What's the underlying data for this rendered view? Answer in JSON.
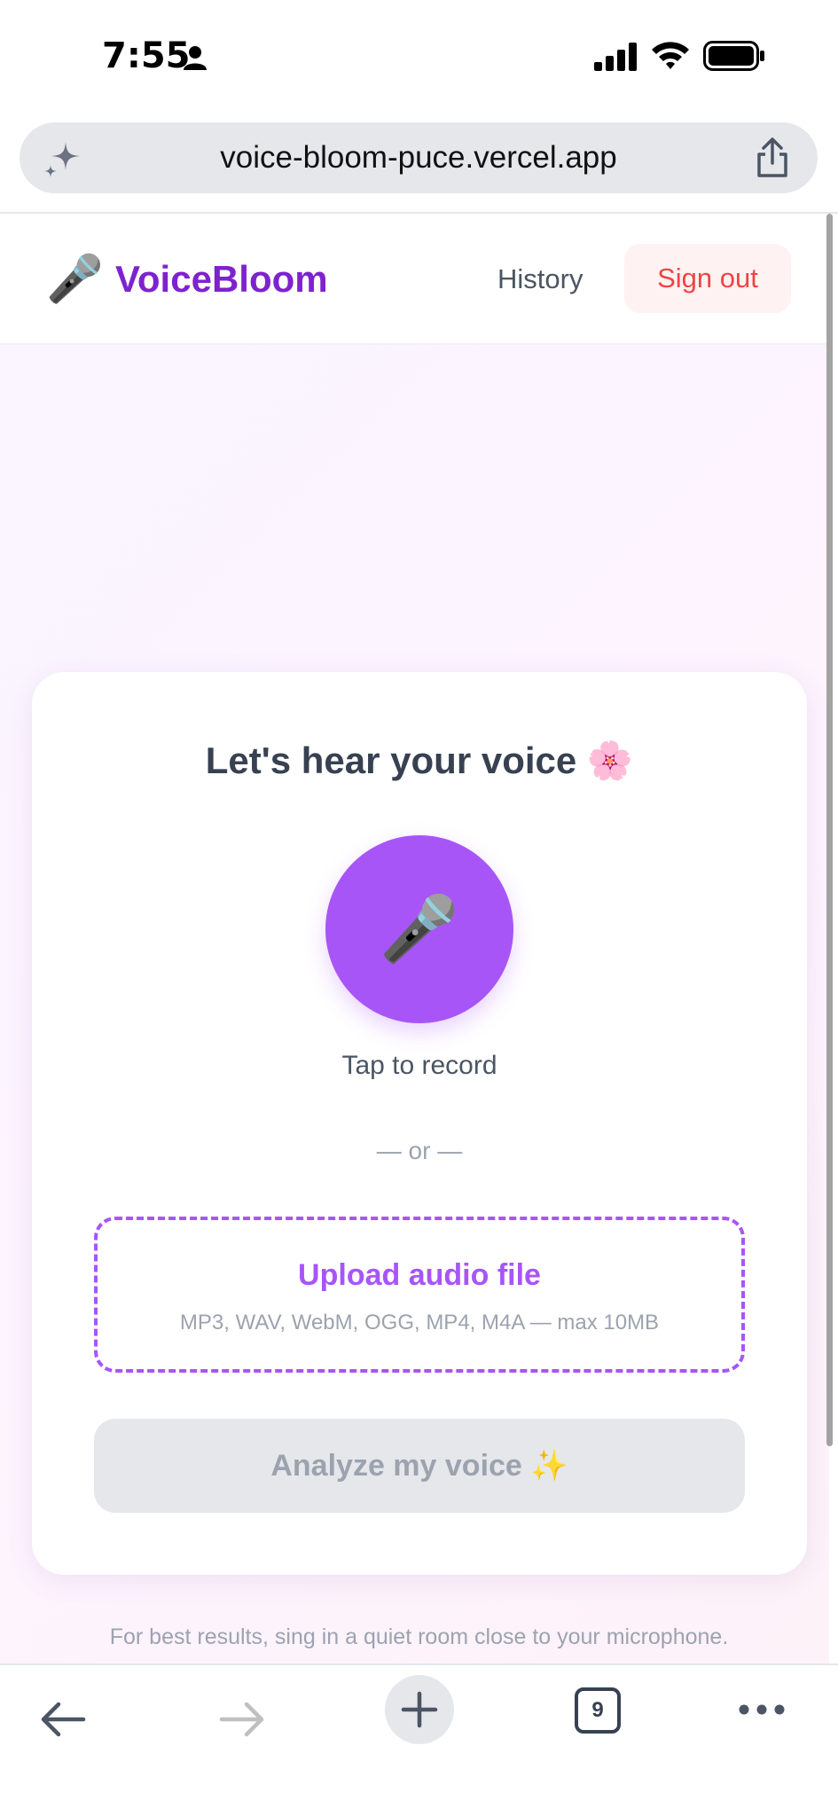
{
  "status_bar": {
    "time": "7:55",
    "icons": [
      "person-icon",
      "cellular-signal-icon",
      "wifi-icon",
      "battery-icon"
    ]
  },
  "browser": {
    "url": "voice-bloom-puce.vercel.app",
    "tab_count": "9",
    "icons": [
      "sparkle-icon",
      "share-icon",
      "back-arrow-icon",
      "forward-arrow-icon",
      "plus-icon",
      "more-icon"
    ]
  },
  "header": {
    "brand_icon": "🎤",
    "brand_name": "VoiceBloom",
    "history_label": "History",
    "signout_label": "Sign out"
  },
  "card": {
    "title": "Let's hear your voice 🌸",
    "record_icon": "🎤",
    "record_label": "Tap to record",
    "or_label": "— or —",
    "upload_label": "Upload audio file",
    "upload_formats": "MP3, WAV, WebM, OGG, MP4, M4A — max 10MB",
    "analyze_label": "Analyze my voice ✨"
  },
  "footer": {
    "hint": "For best results, sing in a quiet room close to your microphone."
  },
  "colors": {
    "brand": "#7e22ce",
    "accent": "#a855f7",
    "danger": "#ef4444",
    "disabled": "#e5e7eb"
  }
}
